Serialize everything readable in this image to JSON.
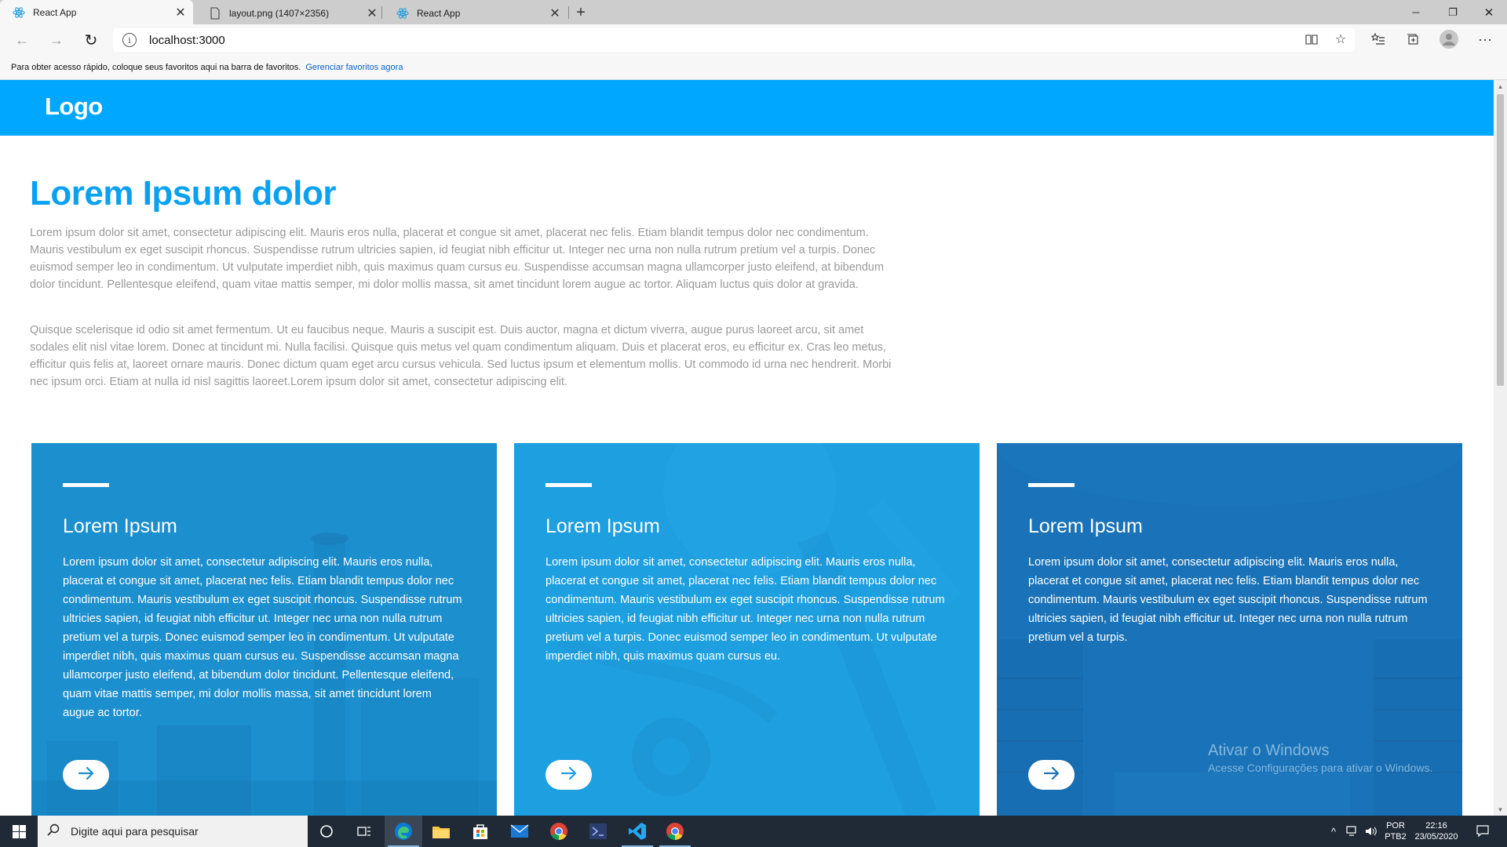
{
  "browser": {
    "tabs": [
      {
        "title": "React App",
        "favicon": "react-icon",
        "active": true
      },
      {
        "title": "layout.png (1407×2356)",
        "favicon": "page-icon",
        "active": false
      },
      {
        "title": "React App",
        "favicon": "react-icon",
        "active": false
      }
    ],
    "new_tab_label": "+",
    "address": "localhost:3000",
    "favorites_prompt": "Para obter acesso rápido, coloque seus favoritos aqui na barra de favoritos.",
    "favorites_link": "Gerenciar favoritos agora"
  },
  "site": {
    "logo": "Logo",
    "hero": {
      "title": "Lorem Ipsum dolor",
      "paragraphs": [
        "Lorem ipsum dolor sit amet, consectetur adipiscing elit. Mauris eros nulla, placerat et congue sit amet, placerat nec felis. Etiam blandit tempus dolor nec condimentum. Mauris vestibulum ex eget suscipit rhoncus. Suspendisse rutrum ultricies sapien, id feugiat nibh efficitur ut. Integer nec urna non nulla rutrum pretium vel a turpis. Donec euismod semper leo in condimentum. Ut vulputate imperdiet nibh, quis maximus quam cursus eu. Suspendisse accumsan magna ullamcorper justo eleifend, at bibendum dolor tincidunt. Pellentesque eleifend, quam vitae mattis semper, mi dolor mollis massa, sit amet tincidunt lorem augue ac tortor. Aliquam luctus quis dolor at gravida.",
        "Quisque scelerisque id odio sit amet fermentum. Ut eu faucibus neque. Mauris a suscipit est. Duis auctor, magna et dictum viverra, augue purus laoreet arcu, sit amet sodales elit nisl vitae lorem. Donec at tincidunt mi. Nulla facilisi. Quisque quis metus vel quam condimentum aliquam. Duis et placerat eros, eu efficitur ex. Cras leo metus, efficitur quis felis at, laoreet ornare mauris. Donec dictum quam eget arcu cursus vehicula. Sed luctus ipsum et elementum mollis. Ut commodo id urna nec hendrerit. Morbi nec ipsum orci. Etiam at nulla id nisl sagittis laoreet.Lorem ipsum dolor sit amet, consectetur adipiscing elit."
      ]
    },
    "cards": [
      {
        "title": "Lorem Ipsum",
        "text": "Lorem ipsum dolor sit amet, consectetur adipiscing elit. Mauris eros nulla, placerat et congue sit amet, placerat nec felis. Etiam blandit tempus dolor nec condimentum. Mauris vestibulum ex eget suscipit rhoncus. Suspendisse rutrum ultricies sapien, id feugiat nibh efficitur ut. Integer nec urna non nulla rutrum pretium vel a turpis. Donec euismod semper leo in condimentum. Ut vulputate imperdiet nibh, quis maximus quam cursus eu. Suspendisse accumsan magna ullamcorper justo eleifend, at bibendum dolor tincidunt. Pellentesque eleifend, quam vitae mattis semper, mi dolor mollis massa, sit amet tincidunt lorem augue ac tortor.",
        "button_icon": "arrow-right-icon",
        "color": "#1c8fcf"
      },
      {
        "title": "Lorem Ipsum",
        "text": "Lorem ipsum dolor sit amet, consectetur adipiscing elit. Mauris eros nulla, placerat et congue sit amet, placerat nec felis. Etiam blandit tempus dolor nec condimentum. Mauris vestibulum ex eget suscipit rhoncus. Suspendisse rutrum ultricies sapien, id feugiat nibh efficitur ut. Integer nec urna non nulla rutrum pretium vel a turpis. Donec euismod semper leo in condimentum. Ut vulputate imperdiet nibh, quis maximus quam cursus eu.",
        "button_icon": "arrow-right-icon",
        "color": "#1d9fe0"
      },
      {
        "title": "Lorem Ipsum",
        "text": "Lorem ipsum dolor sit amet, consectetur adipiscing elit. Mauris eros nulla, placerat et congue sit amet, placerat nec felis. Etiam blandit tempus dolor nec condimentum. Mauris vestibulum ex eget suscipit rhoncus. Suspendisse rutrum ultricies sapien, id feugiat nibh efficitur ut. Integer nec urna non nulla rutrum pretium vel a turpis.",
        "button_icon": "arrow-right-icon",
        "color": "#1a73b8"
      }
    ],
    "watermark": {
      "title": "Ativar o Windows",
      "subtitle": "Acesse Configurações para ativar o Windows."
    }
  },
  "taskbar": {
    "search_placeholder": "Digite aqui para pesquisar",
    "apps": [
      "cortana-icon",
      "task-view-icon",
      "edge-icon",
      "file-explorer-icon",
      "store-icon",
      "mail-icon",
      "chrome-icon",
      "visual-studio-icon",
      "vscode-icon",
      "chrome-icon"
    ],
    "language": "POR",
    "keyboard": "PTB2",
    "time": "22:16",
    "date": "23/05/2020"
  },
  "colors": {
    "brand": "#00a7ff",
    "hero_title": "#0aa1f0",
    "body_text": "#9a9a9a"
  }
}
